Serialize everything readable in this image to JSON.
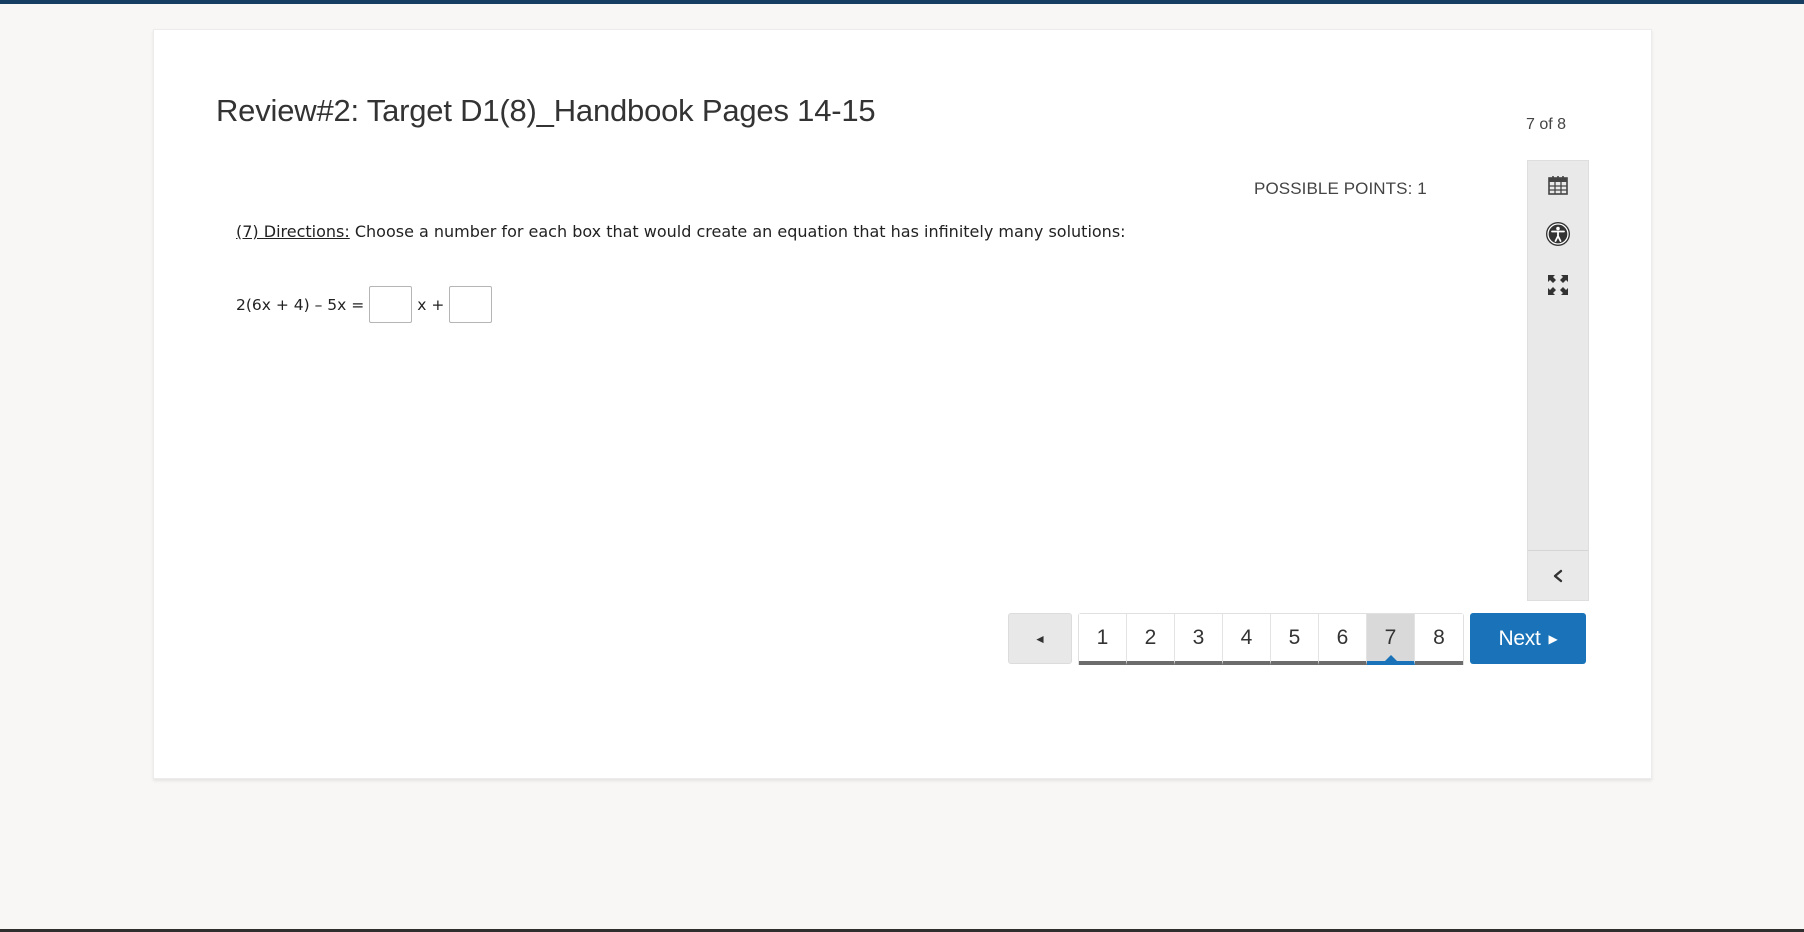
{
  "colors": {
    "top_bar": "#163d62",
    "accent": "#1a73b8",
    "page_bg": "#f8f7f5",
    "toolbar_bg": "#e9e9e9"
  },
  "header": {
    "title": "Review#2: Target D1(8)_Handbook Pages 14-15",
    "question_counter": "7 of 8"
  },
  "question": {
    "possible_points": "POSSIBLE POINTS: 1",
    "directions_label": "(7) Directions:",
    "directions_text": " Choose a number for each box that would create an equation that has infinitely many solutions:",
    "equation_left": "2(6x + 4) – 5x =",
    "equation_middle": "x +",
    "box1_value": "",
    "box2_value": ""
  },
  "toolbar": {
    "icons": [
      {
        "name": "calculator-icon"
      },
      {
        "name": "accessibility-icon"
      },
      {
        "name": "fullscreen-icon"
      },
      {
        "name": "collapse-chevron-icon"
      }
    ]
  },
  "pagination": {
    "prev_glyph": "◄",
    "pages": [
      "1",
      "2",
      "3",
      "4",
      "5",
      "6",
      "7",
      "8"
    ],
    "current_page": "7",
    "next_label": "Next",
    "next_glyph": "▶"
  }
}
